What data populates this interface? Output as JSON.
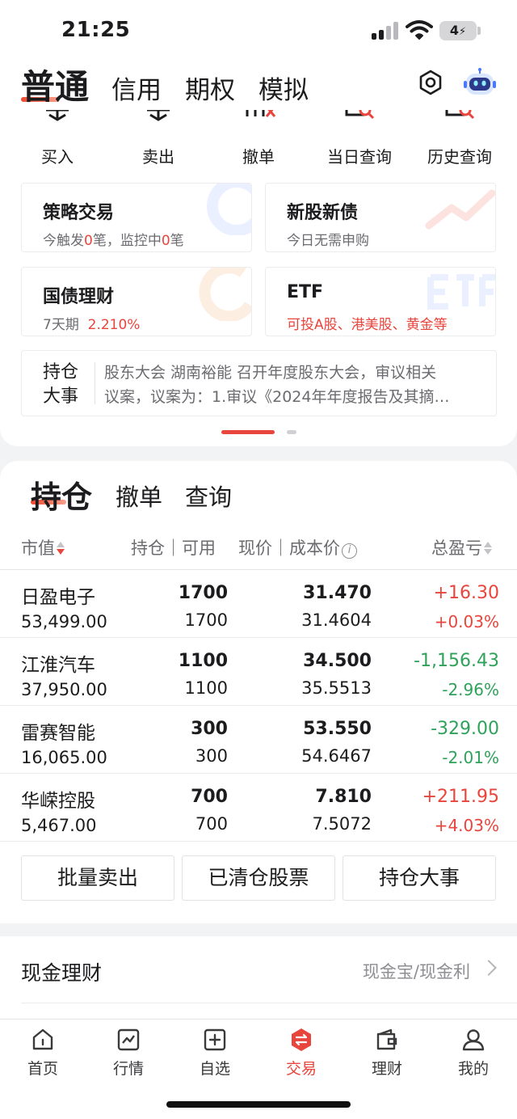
{
  "status": {
    "time": "21:25",
    "battery": "4"
  },
  "header": {
    "tabs": [
      "普通",
      "信用",
      "期权",
      "模拟"
    ]
  },
  "quick_actions": [
    {
      "label": "买入",
      "icon": "buy-icon"
    },
    {
      "label": "卖出",
      "icon": "sell-icon"
    },
    {
      "label": "撤单",
      "icon": "cancel-order-icon"
    },
    {
      "label": "当日查询",
      "icon": "today-query-icon"
    },
    {
      "label": "历史查询",
      "icon": "history-query-icon"
    }
  ],
  "features": {
    "strategy": {
      "title": "策略交易",
      "sub_a": "今触发",
      "count_a": "0",
      "sub_b": "笔，监控中",
      "count_b": "0",
      "sub_c": "笔"
    },
    "ipo": {
      "title": "新股新债",
      "sub": "今日无需申购"
    },
    "bond": {
      "title": "国债理财",
      "term": "7天期",
      "rate": "2.210%"
    },
    "etf": {
      "title": "ETF",
      "sub": "可投A股、港美股、黄金等"
    }
  },
  "news": {
    "title": "持仓大事",
    "line1": "股东大会 湖南裕能 召开年度股东大会，审议相关",
    "line2": "议案，议案为：1.审议《2024年年度报告及其摘…"
  },
  "holdings": {
    "tabs": [
      "持仓",
      "撤单",
      "查询"
    ],
    "columns": {
      "market_value": "市值",
      "position": "持仓｜可用",
      "price": "现价｜成本价",
      "pl": "总盈亏"
    },
    "rows": [
      {
        "name": "日盈电子",
        "market_value": "53,499.00",
        "position": "1700",
        "available": "1700",
        "price": "31.470",
        "cost": "31.4604",
        "pl": "+16.30",
        "pl_pct": "+0.03%",
        "direction": "up"
      },
      {
        "name": "江淮汽车",
        "market_value": "37,950.00",
        "position": "1100",
        "available": "1100",
        "price": "34.500",
        "cost": "35.5513",
        "pl": "-1,156.43",
        "pl_pct": "-2.96%",
        "direction": "down"
      },
      {
        "name": "雷赛智能",
        "market_value": "16,065.00",
        "position": "300",
        "available": "300",
        "price": "53.550",
        "cost": "54.6467",
        "pl": "-329.00",
        "pl_pct": "-2.01%",
        "direction": "down"
      },
      {
        "name": "华嵘控股",
        "market_value": "5,467.00",
        "position": "700",
        "available": "700",
        "price": "7.810",
        "cost": "7.5072",
        "pl": "+211.95",
        "pl_pct": "+4.03%",
        "direction": "up"
      }
    ],
    "buttons": [
      "批量卖出",
      "已清仓股票",
      "持仓大事"
    ]
  },
  "cash": {
    "title": "现金理财",
    "link": "现金宝/现金利"
  },
  "bottom_nav": [
    {
      "label": "首页",
      "icon": "home-icon",
      "active": false
    },
    {
      "label": "行情",
      "icon": "market-chart-icon",
      "active": false
    },
    {
      "label": "自选",
      "icon": "watchlist-plus-icon",
      "active": false
    },
    {
      "label": "交易",
      "icon": "trade-exchange-icon",
      "active": true
    },
    {
      "label": "理财",
      "icon": "wallet-icon",
      "active": false
    },
    {
      "label": "我的",
      "icon": "profile-icon",
      "active": false
    }
  ],
  "colors": {
    "accent": "#e8453c",
    "up": "#e8453c",
    "down": "#2fa25a"
  }
}
